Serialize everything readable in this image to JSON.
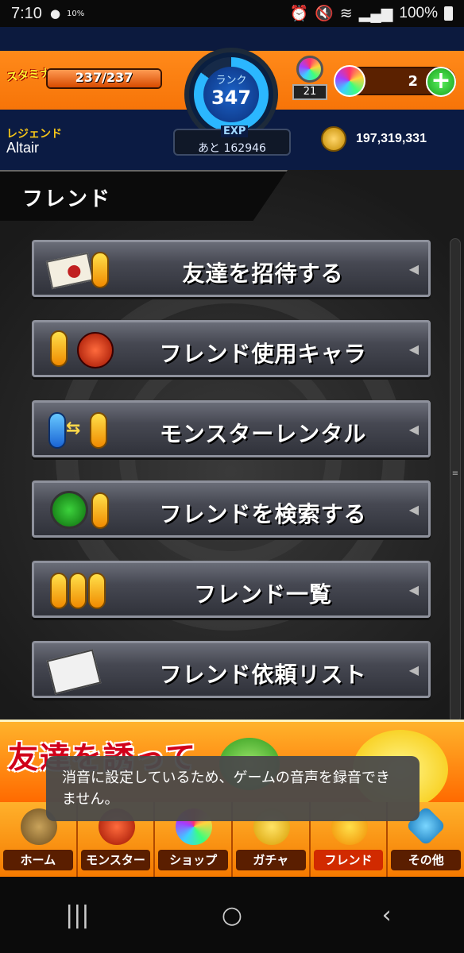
{
  "status_bar": {
    "time": "7:10",
    "notif_percent": "10%",
    "battery": "100%"
  },
  "header": {
    "stamina_label": "スタミナ",
    "stamina_value": "237/237",
    "stamina_fraction": 1.0,
    "rank_label": "ランク",
    "rank_value": "347",
    "exp_label": "EXP",
    "exp_remaining": "あと 162946",
    "title_label": "レジェンド",
    "player_name": "Altair",
    "stash_count": "21",
    "orb_count": "2",
    "coins": "197,319,331"
  },
  "section": {
    "title": "フレンド"
  },
  "menu": [
    {
      "label": "友達を招待する",
      "icon": "invite-envelope-icon"
    },
    {
      "label": "フレンド使用キャラ",
      "icon": "friend-character-icon"
    },
    {
      "label": "モンスターレンタル",
      "icon": "monster-rental-icon"
    },
    {
      "label": "フレンドを検索する",
      "icon": "friend-search-icon"
    },
    {
      "label": "フレンド一覧",
      "icon": "friend-list-icon"
    },
    {
      "label": "フレンド依頼リスト",
      "icon": "friend-request-list-icon"
    }
  ],
  "banner": {
    "text": "友達を誘って"
  },
  "toast": {
    "message": "消音に設定しているため、ゲームの音声を録音できません。"
  },
  "bottom_nav": [
    {
      "label": "ホーム"
    },
    {
      "label": "モンスター"
    },
    {
      "label": "ショップ"
    },
    {
      "label": "ガチャ"
    },
    {
      "label": "フレンド"
    },
    {
      "label": "その他"
    }
  ],
  "colors": {
    "accent_orange": "#f57a00",
    "header_blue": "#0b1b43",
    "button_gray": "#464852"
  }
}
